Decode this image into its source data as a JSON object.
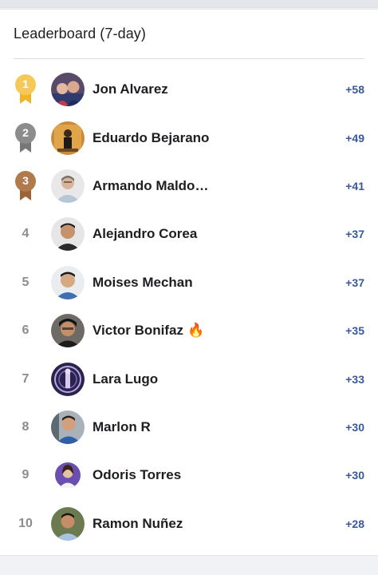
{
  "leaderboard": {
    "title": "Leaderboard (7-day)",
    "entries": [
      {
        "rank": "1",
        "name": "Jon Alvarez",
        "points": "+58"
      },
      {
        "rank": "2",
        "name": "Eduardo Bejarano",
        "points": "+49"
      },
      {
        "rank": "3",
        "name": "Armando Maldo…",
        "points": "+41"
      },
      {
        "rank": "4",
        "name": "Alejandro Corea",
        "points": "+37"
      },
      {
        "rank": "5",
        "name": "Moises Mechan",
        "points": "+37"
      },
      {
        "rank": "6",
        "name": "Victor Bonifaz",
        "points": "+35"
      },
      {
        "rank": "7",
        "name": "Lara Lugo",
        "points": "+33"
      },
      {
        "rank": "8",
        "name": "Marlon R",
        "points": "+30"
      },
      {
        "rank": "9",
        "name": "Odoris Torres",
        "points": "+30"
      },
      {
        "rank": "10",
        "name": "Ramon Nuñez",
        "points": "+28"
      }
    ]
  },
  "icons": {
    "medal_gold": "medal-gold-icon",
    "medal_silver": "medal-silver-icon",
    "medal_bronze": "medal-bronze-icon",
    "fire": "fire-icon"
  },
  "colors": {
    "gold": "#f5c85a",
    "silver": "#8c8c8c",
    "bronze": "#b07a4b",
    "points": "#385898"
  }
}
